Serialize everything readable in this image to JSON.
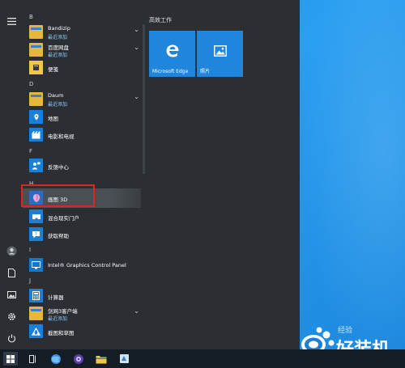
{
  "rail": {
    "icons": [
      "hamburger-menu-icon",
      "user-icon",
      "document-icon",
      "pictures-icon",
      "settings-icon",
      "power-icon"
    ]
  },
  "app_list": {
    "sections": [
      {
        "letter": "B"
      },
      {
        "letter": "D"
      },
      {
        "letter": "F"
      },
      {
        "letter": "H"
      },
      {
        "letter": "I"
      },
      {
        "letter": "J"
      }
    ],
    "apps": [
      {
        "name": "Bandizip",
        "sub": "最近添加",
        "icon": "folder-icon"
      },
      {
        "name": "百度网盘",
        "sub": "最近添加",
        "icon": "folder-icon"
      },
      {
        "name": "便笺",
        "sub": "",
        "icon": "sticky-notes-icon"
      },
      {
        "name": "Daum",
        "sub": "最近添加",
        "icon": "folder-icon"
      },
      {
        "name": "地图",
        "sub": "",
        "icon": "maps-icon"
      },
      {
        "name": "电影和电视",
        "sub": "",
        "icon": "movies-tv-icon"
      },
      {
        "name": "反馈中心",
        "sub": "",
        "icon": "feedback-hub-icon"
      },
      {
        "name": "画图 3D",
        "sub": "",
        "icon": "paint-3d-icon"
      },
      {
        "name": "混合现实门户",
        "sub": "",
        "icon": "mixed-reality-icon"
      },
      {
        "name": "获取帮助",
        "sub": "",
        "icon": "get-help-icon"
      },
      {
        "name": "Intel® Graphics Control Panel",
        "sub": "",
        "icon": "intel-graphics-icon"
      },
      {
        "name": "计算器",
        "sub": "",
        "icon": "calculator-icon"
      },
      {
        "name": "剑网3客户端",
        "sub": "最近添加",
        "icon": "folder-icon"
      },
      {
        "name": "截图和草图",
        "sub": "",
        "icon": "snip-sketch-icon"
      }
    ]
  },
  "tiles": {
    "header": "高效工作",
    "items": [
      {
        "label": "Microsoft Edge",
        "icon": "edge-icon"
      },
      {
        "label": "照片",
        "icon": "photos-icon"
      }
    ]
  },
  "taskbar": {
    "items": [
      "windows-start-icon",
      "task-view-icon",
      "browser-icon",
      "game-icon",
      "file-explorer-icon",
      "app-icon"
    ]
  },
  "watermark": {
    "main": "好装机",
    "small": "经验"
  },
  "colors": {
    "menu_bg": "#2b2f33",
    "accent": "#1f86dc",
    "highlight": "#e0251f",
    "desktop": "#2a9ef0",
    "taskbar": "#141c24"
  }
}
